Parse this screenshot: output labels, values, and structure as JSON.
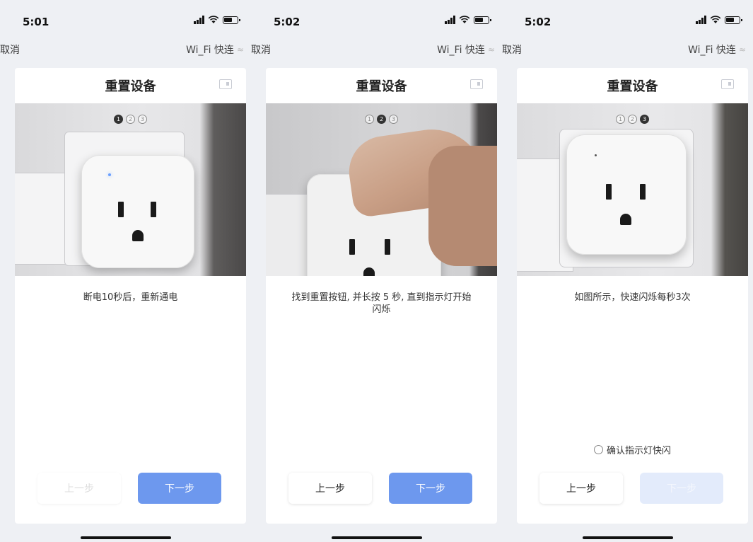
{
  "screens": [
    {
      "status": {
        "time": "5:01"
      },
      "nav": {
        "cancel": "取消",
        "wifi": "Wi_Fi 快连"
      },
      "card": {
        "title": "重置设备",
        "steps": [
          "1",
          "2",
          "3"
        ],
        "active_step": 1,
        "hint": "断电10秒后，重新通电",
        "prev_label": "上一步",
        "next_label": "下一步",
        "prev_enabled": false,
        "next_enabled": true
      }
    },
    {
      "status": {
        "time": "5:02"
      },
      "nav": {
        "cancel": "取消",
        "wifi": "Wi_Fi 快连"
      },
      "card": {
        "title": "重置设备",
        "steps": [
          "1",
          "2",
          "3"
        ],
        "active_step": 2,
        "hint": "找到重置按钮, 并长按 5 秒, 直到指示灯开始闪烁",
        "prev_label": "上一步",
        "next_label": "下一步",
        "prev_enabled": true,
        "next_enabled": true
      }
    },
    {
      "status": {
        "time": "5:02"
      },
      "nav": {
        "cancel": "取消",
        "wifi": "Wi_Fi 快连"
      },
      "card": {
        "title": "重置设备",
        "steps": [
          "1",
          "2",
          "3"
        ],
        "active_step": 3,
        "hint": "如图所示，快速闪烁每秒3次",
        "confirm_label": "确认指示灯快闪",
        "prev_label": "上一步",
        "next_label": "下一步",
        "prev_enabled": true,
        "next_enabled": false
      }
    }
  ]
}
